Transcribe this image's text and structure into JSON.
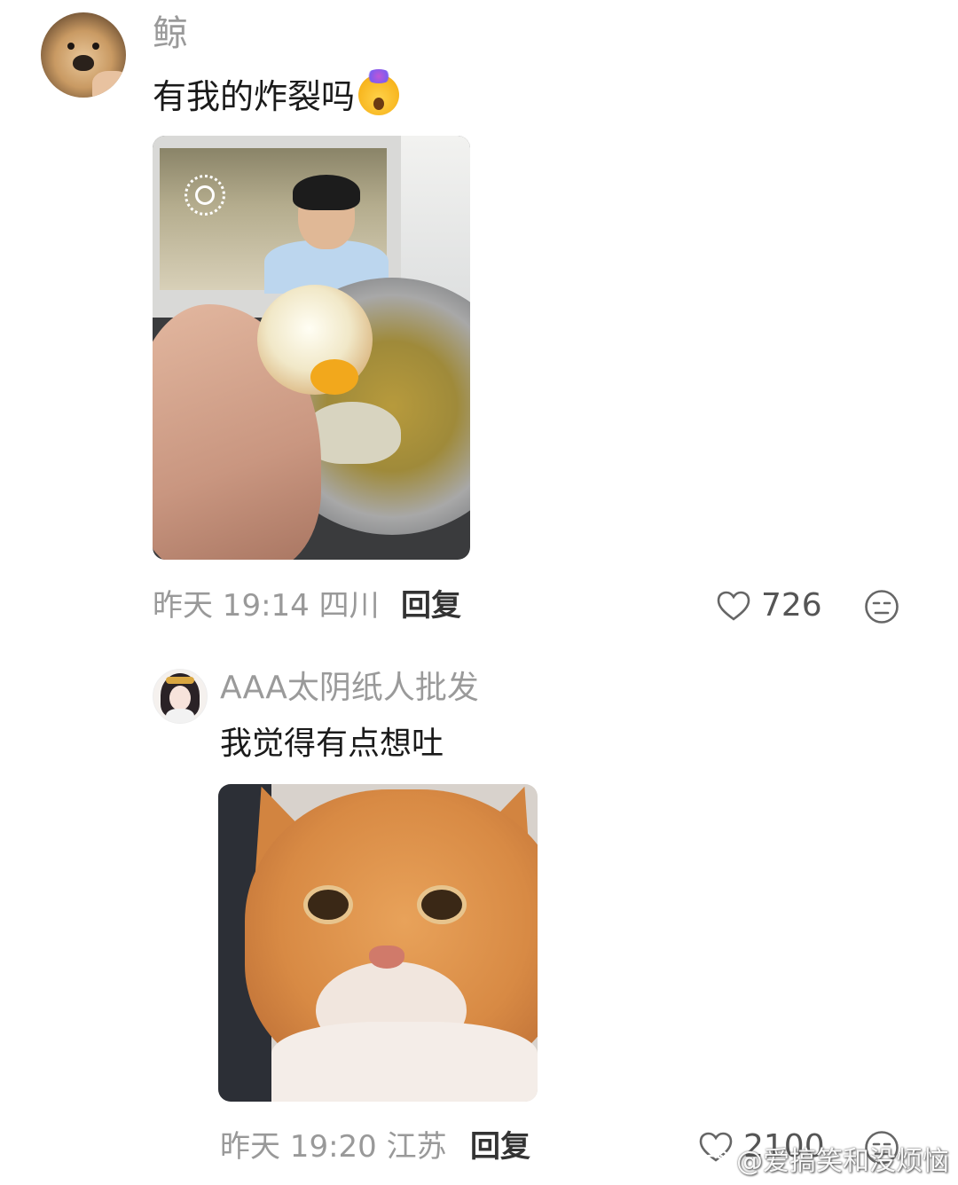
{
  "comment": {
    "username": "鲸",
    "text": "有我的炸裂吗",
    "emoji": "exploding-head-emoji",
    "time": "昨天 19:14 四川",
    "reply_label": "回复",
    "likes": "726"
  },
  "reply": {
    "username": "AAA太阴纸人批发",
    "text": "我觉得有点想吐",
    "time": "昨天 19:20 江苏",
    "reply_label": "回复",
    "likes": "2100"
  },
  "watermark": "@爱搞笑和没烦恼",
  "icons": {
    "like": "heart-outline-icon",
    "more": "neutral-face-icon",
    "watermark_logo": "weibo-logo-icon"
  }
}
